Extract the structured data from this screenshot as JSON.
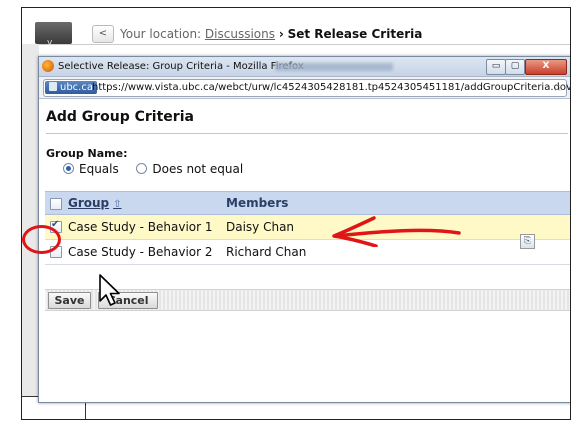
{
  "background_page": {
    "location_prefix": "Your location:",
    "breadcrumb_link": "Discussions",
    "breadcrumb_sep": "›",
    "breadcrumb_current": "Set Release Criteria",
    "back_label": "<",
    "tab_arrow": "v"
  },
  "popup": {
    "window_title": "Selective Release: Group Criteria - Mozilla Firefox",
    "window_buttons": {
      "minimize": "▭",
      "maximize": "▢",
      "close": "X"
    },
    "site_badge": "ubc.ca",
    "url": "https://www.vista.ubc.ca/webct/urw/lc4524305428181.tp4524305451181/addGroupCriteria.dov",
    "star": "☆"
  },
  "form": {
    "heading": "Add Group Criteria",
    "group_name_label": "Group Name:",
    "radio_options": [
      {
        "label": "Equals",
        "selected": true
      },
      {
        "label": "Does not equal",
        "selected": false
      }
    ],
    "table": {
      "headers": {
        "group": "Group",
        "sort_glyph": "⇧",
        "members": "Members"
      },
      "rows": [
        {
          "group": "Case Study - Behavior 1",
          "members": "Daisy Chan",
          "checked": true
        },
        {
          "group": "Case Study - Behavior 2",
          "members": "Richard Chan",
          "checked": false
        }
      ]
    },
    "buttons": {
      "save": "Save",
      "cancel": "Cancel"
    },
    "icon_glyph": "⎘"
  },
  "annotation_colors": {
    "highlight_red": "#e01515"
  }
}
